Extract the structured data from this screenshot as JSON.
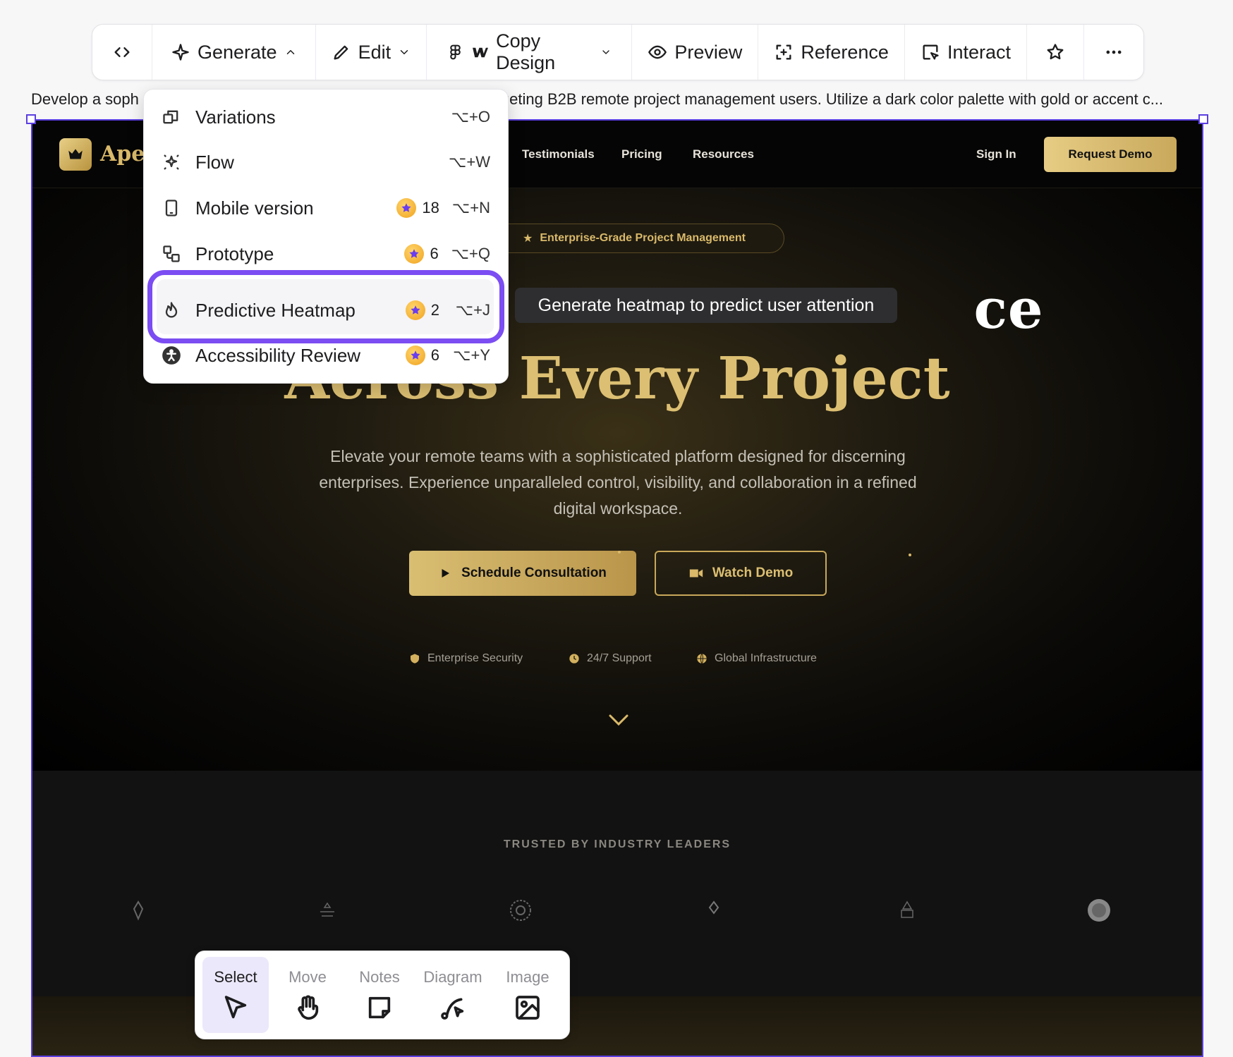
{
  "toolbar": {
    "generate": "Generate",
    "edit": "Edit",
    "copy_design": "Copy Design",
    "preview": "Preview",
    "reference": "Reference",
    "interact": "Interact"
  },
  "prompt_text": "Develop a soph",
  "prompt_text_tail": "geting B2B remote project management users. Utilize a dark color palette with gold or accent c...",
  "site": {
    "brand": "Apex",
    "nav": [
      "Testimonials",
      "Pricing",
      "Resources"
    ],
    "sign_in": "Sign In",
    "request_demo": "Request Demo",
    "badge": "Enterprise-Grade Project Management",
    "headline_1": "ce",
    "headline_2": "Across Every Project",
    "subtitle": "Elevate your remote teams with a sophisticated platform designed for discerning enterprises. Experience unparalleled control, visibility, and collaboration in a refined digital workspace.",
    "cta_primary": "Schedule Consultation",
    "cta_secondary": "Watch Demo",
    "features": [
      "Enterprise Security",
      "24/7 Support",
      "Global Infrastructure"
    ],
    "trusted_title": "TRUSTED BY INDUSTRY LEADERS",
    "colors": {
      "gold": "#d9b96a",
      "background": "#000000"
    }
  },
  "menu": {
    "items": [
      {
        "label": "Variations",
        "cost": "",
        "shortcut": "⌥+O",
        "icon": "variations-icon"
      },
      {
        "label": "Flow",
        "cost": "",
        "shortcut": "⌥+W",
        "icon": "flow-icon"
      },
      {
        "label": "Mobile version",
        "cost": "18",
        "shortcut": "⌥+N",
        "icon": "mobile-icon"
      },
      {
        "label": "Prototype",
        "cost": "6",
        "shortcut": "⌥+Q",
        "icon": "prototype-icon"
      },
      {
        "label": "Predictive Heatmap",
        "cost": "2",
        "shortcut": "⌥+J",
        "icon": "flame-icon"
      },
      {
        "label": "Accessibility Review",
        "cost": "6",
        "shortcut": "⌥+Y",
        "icon": "accessibility-icon"
      }
    ]
  },
  "tooltip": "Generate heatmap to predict user attention",
  "tools": [
    "Select",
    "Move",
    "Notes",
    "Diagram",
    "Image"
  ],
  "accent_color": "#7b4df2"
}
